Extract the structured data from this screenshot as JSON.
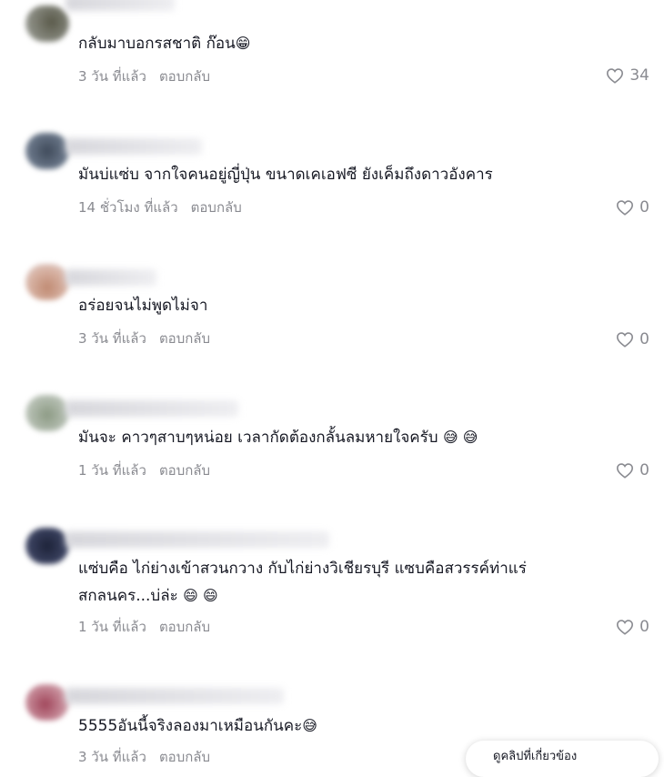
{
  "comments": [
    {
      "text": "กลับมาบอกรสชาติ ก๊อน",
      "emoji": "😁",
      "time": "3 วัน ที่แล้ว",
      "reply": "ตอบกลับ",
      "likes": "34"
    },
    {
      "text": "มันบ่แซ่บ จากใจคนอยู่ญี่ปุ่น ขนาดเคเอฟซี ยังเค็มถึงดาวอังคาร",
      "time": "14 ชั่วโมง ที่แล้ว",
      "reply": "ตอบกลับ",
      "likes": "0"
    },
    {
      "text": "อร่อยจนไม่พูดไม่จา",
      "time": "3 วัน ที่แล้ว",
      "reply": "ตอบกลับ",
      "likes": "0"
    },
    {
      "text": "มันจะ คาวๆสาบๆหน่อย เวลากัดต้องกลั้นลมหายใจครับ",
      "emoji": "😅 😅",
      "time": "1 วัน ที่แล้ว",
      "reply": "ตอบกลับ",
      "likes": "0"
    },
    {
      "text": "แซ่บคือ ไก่ย่างเข้าสวนกวาง กับไก่ย่างวิเชียรบุรี แซบคือสวรรค์ท่าแร่ สกลนคร...บ่ล่ะ",
      "emoji": "😄 😄",
      "time": "1 วัน ที่แล้ว",
      "reply": "ตอบกลับ",
      "likes": "0"
    },
    {
      "text": "5555อันนี้จริงลองมาเหมือนกันคะ",
      "emoji": "😅",
      "time": "3 วัน ที่แล้ว",
      "reply": "ตอบกลับ"
    }
  ],
  "colors": {
    "text": "#161823",
    "muted": "#8a8b91",
    "background": "#ffffff"
  },
  "icons": {
    "like": "heart-outline-icon"
  },
  "floating_pill": {
    "text": "ดูคลิปที่เกี่ยวข้อง"
  }
}
